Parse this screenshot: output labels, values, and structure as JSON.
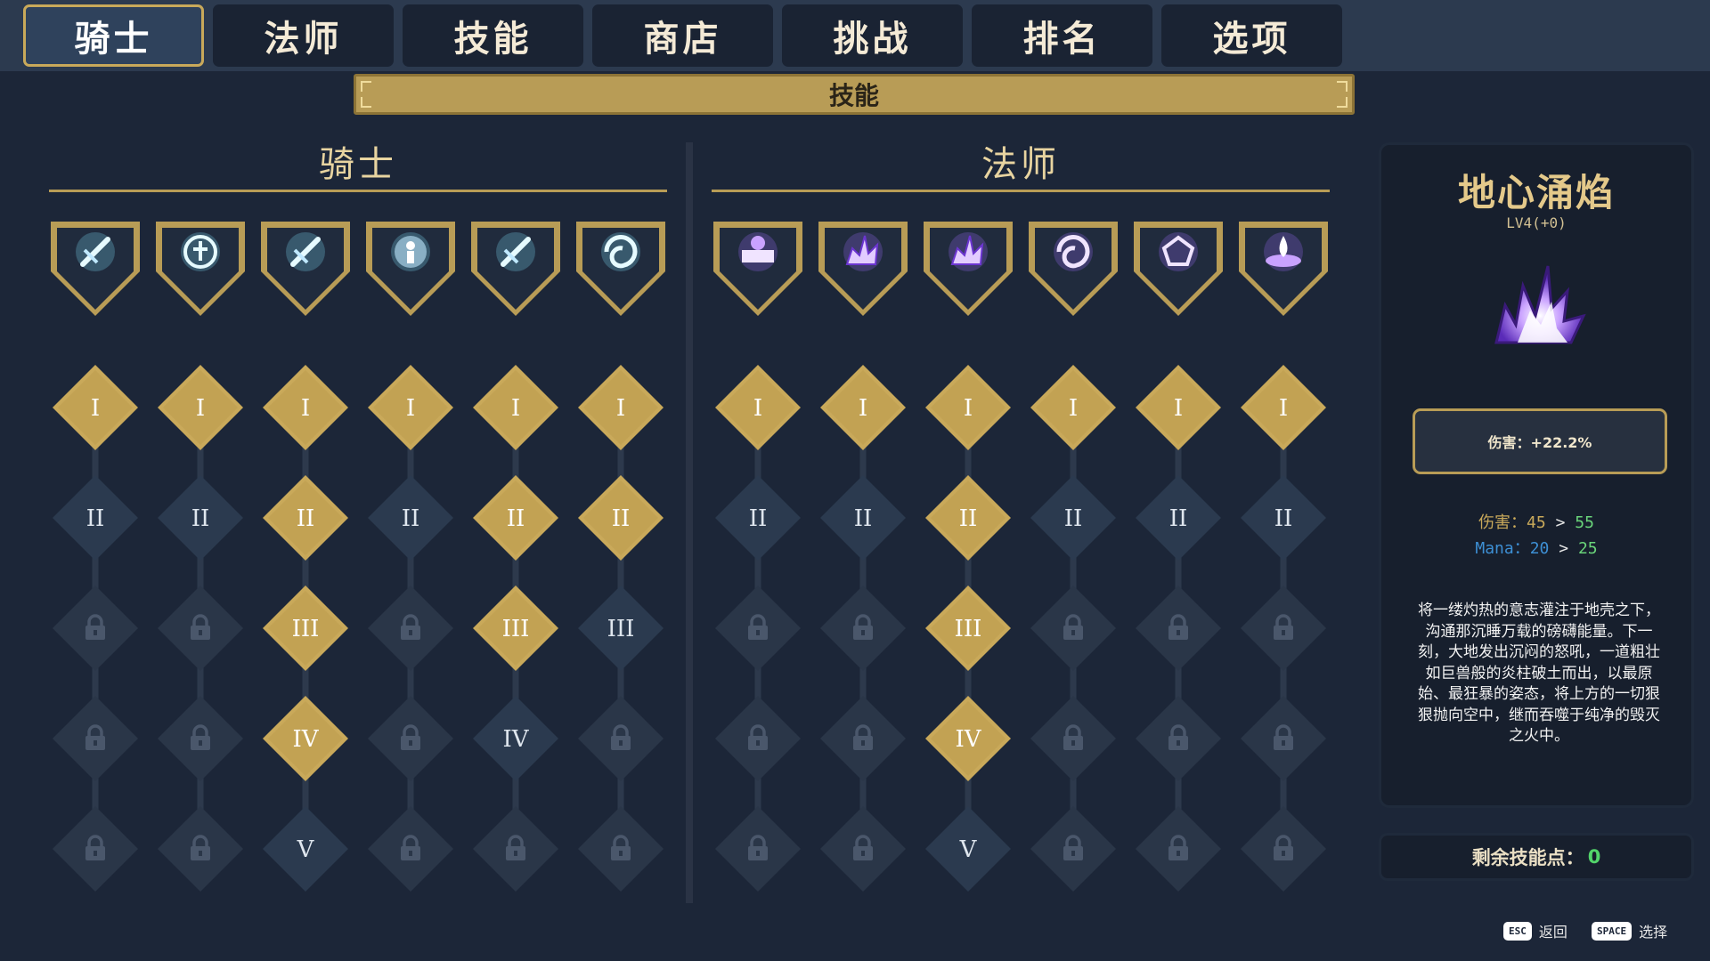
{
  "tabs": [
    {
      "label": "骑士",
      "active": true
    },
    {
      "label": "法师",
      "active": false
    },
    {
      "label": "技能",
      "active": false
    },
    {
      "label": "商店",
      "active": false
    },
    {
      "label": "挑战",
      "active": false
    },
    {
      "label": "排名",
      "active": false
    },
    {
      "label": "选项",
      "active": false
    }
  ],
  "banner": {
    "title": "技能"
  },
  "trees": [
    {
      "class_name": "骑士",
      "skills": [
        {
          "icon": "sword-strike-icon",
          "max_unlocked": 1,
          "max_rank": 2
        },
        {
          "icon": "holy-shield-icon",
          "max_unlocked": 1,
          "max_rank": 2
        },
        {
          "icon": "sword-dash-icon",
          "max_unlocked": 4,
          "max_rank": 5
        },
        {
          "icon": "spirit-guard-icon",
          "max_unlocked": 1,
          "max_rank": 2
        },
        {
          "icon": "wing-slash-icon",
          "max_unlocked": 3,
          "max_rank": 4
        },
        {
          "icon": "whirlwind-icon",
          "max_unlocked": 2,
          "max_rank": 3
        }
      ]
    },
    {
      "class_name": "法师",
      "skills": [
        {
          "icon": "spellbook-icon",
          "max_unlocked": 1,
          "max_rank": 2
        },
        {
          "icon": "arcane-burst-icon",
          "max_unlocked": 1,
          "max_rank": 2
        },
        {
          "icon": "earth-eruption-icon",
          "max_unlocked": 4,
          "max_rank": 5
        },
        {
          "icon": "arcane-orb-icon",
          "max_unlocked": 1,
          "max_rank": 2
        },
        {
          "icon": "crystal-shield-icon",
          "max_unlocked": 1,
          "max_rank": 2
        },
        {
          "icon": "flame-pool-icon",
          "max_unlocked": 1,
          "max_rank": 2
        }
      ]
    }
  ],
  "rank_numerals": [
    "I",
    "II",
    "III",
    "IV",
    "V"
  ],
  "detail": {
    "name": "地心涌焰",
    "level": "LV4(+0)",
    "icon": "earth-eruption-icon",
    "stat_box": "伤害：+22.2%",
    "damage_label": "伤害：",
    "damage_from": "45",
    "damage_to": "55",
    "mana_label": "Mana：",
    "mana_from": "20",
    "mana_to": "25",
    "arrow": ">",
    "description": "将一缕灼热的意志灌注于地壳之下，沟通那沉睡万载的磅礴能量。下一刻，大地发出沉闷的怒吼，一道粗壮如巨兽般的炎柱破土而出，以最原始、最狂暴的姿态，将上方的一切狠狠抛向空中，继而吞噬于纯净的毁灭之火中。"
  },
  "points": {
    "label": "剩余技能点：",
    "value": "0"
  },
  "hints": [
    {
      "key": "ESC",
      "label": "返回"
    },
    {
      "key": "SPACE",
      "label": "选择"
    }
  ],
  "colors": {
    "background": "#1c2638",
    "gold": "#c9a95a",
    "locked": "#2a3648",
    "available": "#2b3a4f",
    "arcane_purple": "#9b6bff",
    "frost_cyan": "#7fe4ff"
  }
}
